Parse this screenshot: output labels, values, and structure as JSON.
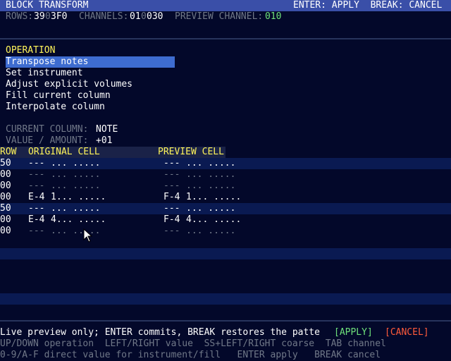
{
  "header": {
    "title": "BLOCK TRANSFORM",
    "hint": "ENTER: APPLY  BREAK: CANCEL"
  },
  "status": {
    "rows_label": "ROWS:",
    "rows_a": "39",
    "rows_sep": "0",
    "rows_b": "3F0",
    "channels_label": "CHANNELS:",
    "channels_a": "01",
    "channels_sep": "0",
    "channels_b": "030",
    "preview_label": "PREVIEW CHANNEL:",
    "preview_value": "010"
  },
  "operation": {
    "heading": "OPERATION",
    "items": [
      "Transpose notes",
      "Set instrument",
      "Adjust explicit volumes",
      "Fill current column",
      "Interpolate column"
    ],
    "selected_index": 0
  },
  "params": {
    "column_label": "CURRENT COLUMN:",
    "column_value": "NOTE",
    "value_label": "VALUE / AMOUNT:",
    "value_value": "+01"
  },
  "table": {
    "headers": {
      "row": "ROW",
      "original": "ORIGINAL CELL",
      "preview": "PREVIEW CELL"
    },
    "rows": [
      {
        "row": "50",
        "orig_note": "---",
        "orig_rest": "... .....",
        "prev_note": "---",
        "prev_rest": "... .....",
        "orig_dim": false,
        "band": true
      },
      {
        "row": "00",
        "orig_note": "---",
        "orig_rest": "... .....",
        "prev_note": "---",
        "prev_rest": "... .....",
        "orig_dim": true,
        "band": false
      },
      {
        "row": "00",
        "orig_note": "---",
        "orig_rest": "... .....",
        "prev_note": "---",
        "prev_rest": "... .....",
        "orig_dim": true,
        "band": false
      },
      {
        "row": "00",
        "orig_note": "E-4",
        "orig_rest": "1... .....",
        "prev_note": "F-4",
        "prev_rest": "1... .....",
        "orig_dim": false,
        "band": false
      },
      {
        "row": "50",
        "orig_note": "---",
        "orig_rest": "... .....",
        "prev_note": "---",
        "prev_rest": "... .....",
        "orig_dim": false,
        "band": true
      },
      {
        "row": "00",
        "orig_note": "E-4",
        "orig_rest": "4... .....",
        "prev_note": "F-4",
        "prev_rest": "4... .....",
        "orig_dim": false,
        "band": false
      },
      {
        "row": "00",
        "orig_note": "---",
        "orig_rest": "... .....",
        "prev_note": "---",
        "prev_rest": "... .....",
        "orig_dim": true,
        "band": false
      }
    ]
  },
  "footer": {
    "message": "Live preview only; ENTER commits, BREAK restores the patte",
    "apply_label": "[APPLY]",
    "cancel_label": "[CANCEL]",
    "help1": "UP/DOWN operation  LEFT/RIGHT value  SS+LEFT/RIGHT coarse  TAB channel",
    "help2": "0-9/A-F direct value for instrument/fill   ENTER apply   BREAK cancel"
  },
  "colors": {
    "background": "#03082a",
    "title_bar": "#3a4fa8",
    "selection": "#3e6cd0",
    "heading": "#fff45a",
    "apply": "#6ee07a",
    "cancel": "#ff5a3a"
  }
}
